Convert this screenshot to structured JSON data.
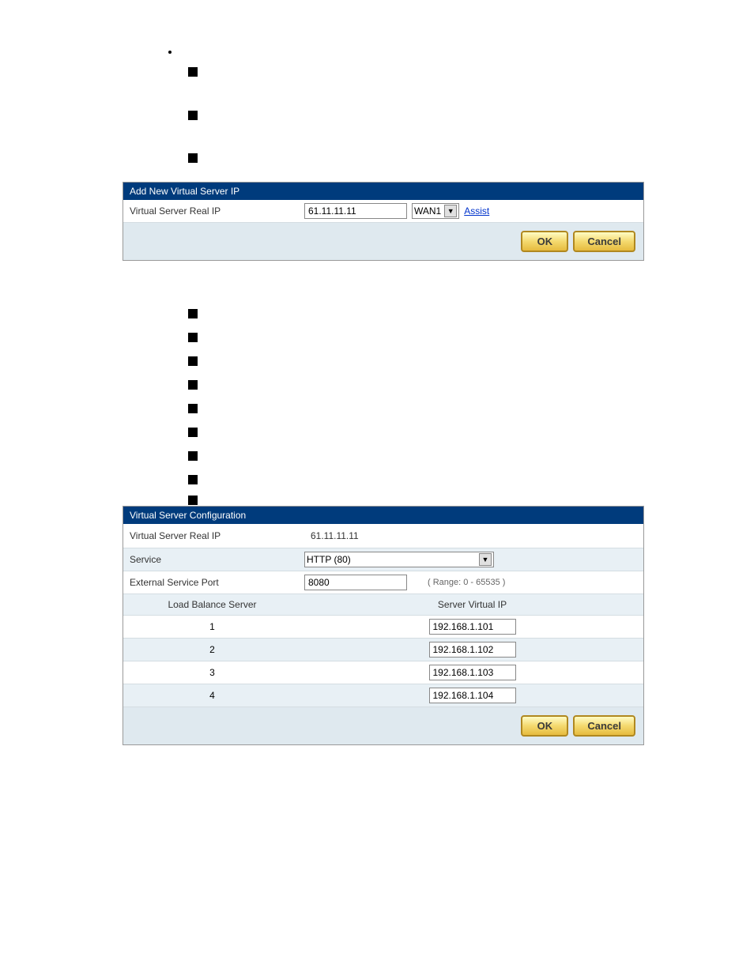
{
  "panel1": {
    "title": "Add New Virtual Server IP",
    "label": "Virtual Server Real IP",
    "ip_value": "61.11.11.11",
    "wan_value": "WAN1",
    "assist_link": "Assist",
    "ok": "OK",
    "cancel": "Cancel"
  },
  "panel2": {
    "title": "Virtual Server Configuration",
    "rows": {
      "real_ip_label": "Virtual Server Real IP",
      "real_ip_value": "61.11.11.11",
      "service_label": "Service",
      "service_value": "HTTP (80)",
      "ext_port_label": "External Service Port",
      "ext_port_value": "8080",
      "ext_port_hint": "( Range: 0 - 65535 )"
    },
    "table_header_left": "Load Balance Server",
    "table_header_right": "Server Virtual IP",
    "servers": [
      {
        "num": "1",
        "ip": "192.168.1.101"
      },
      {
        "num": "2",
        "ip": "192.168.1.102"
      },
      {
        "num": "3",
        "ip": "192.168.1.103"
      },
      {
        "num": "4",
        "ip": "192.168.1.104"
      }
    ],
    "ok": "OK",
    "cancel": "Cancel"
  }
}
